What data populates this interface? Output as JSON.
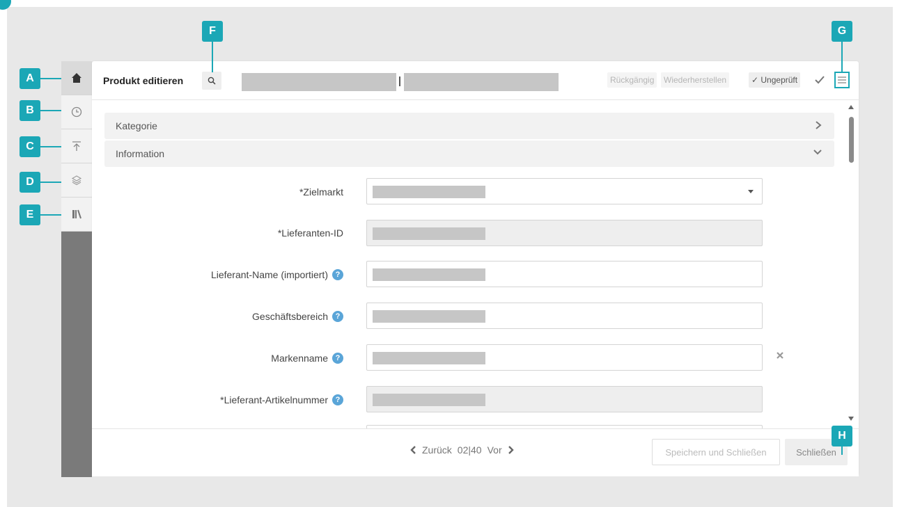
{
  "header": {
    "title": "Produkt editieren",
    "undo_label": "Rückgängig",
    "redo_label": "Wiederherstellen",
    "status_label": "✓ Ungeprüft"
  },
  "callouts": [
    "A",
    "B",
    "C",
    "D",
    "E",
    "F",
    "G",
    "H"
  ],
  "sidebar": {
    "items": [
      {
        "icon": "home-icon"
      },
      {
        "icon": "clock-icon"
      },
      {
        "icon": "upload-icon"
      },
      {
        "icon": "layers-icon"
      },
      {
        "icon": "library-icon"
      }
    ]
  },
  "sections": [
    {
      "label": "Kategorie",
      "state": "collapsed"
    },
    {
      "label": "Information",
      "state": "expanded"
    }
  ],
  "fields": [
    {
      "label": "*Zielmarkt",
      "help": false,
      "type": "select",
      "readonly": false
    },
    {
      "label": "*Lieferanten-ID",
      "help": false,
      "type": "text",
      "readonly": true
    },
    {
      "label": "Lieferant-Name (importiert)",
      "help": true,
      "type": "text",
      "readonly": false
    },
    {
      "label": "Geschäftsbereich",
      "help": true,
      "type": "text",
      "readonly": false
    },
    {
      "label": "Markenname",
      "help": true,
      "type": "text",
      "readonly": false,
      "clearable": true
    },
    {
      "label": "*Lieferant-Artikelnummer",
      "help": true,
      "type": "text",
      "readonly": true
    }
  ],
  "help_glyph": "?",
  "footer": {
    "prev_label": "Zurück",
    "page_current": "02",
    "page_sep": "|",
    "page_total": "40",
    "next_label": "Vor",
    "save_close_label": "Speichern und Schließen",
    "close_label": "Schließen"
  },
  "colors": {
    "accent": "#1ba7b6",
    "help": "#5aa5d8"
  }
}
